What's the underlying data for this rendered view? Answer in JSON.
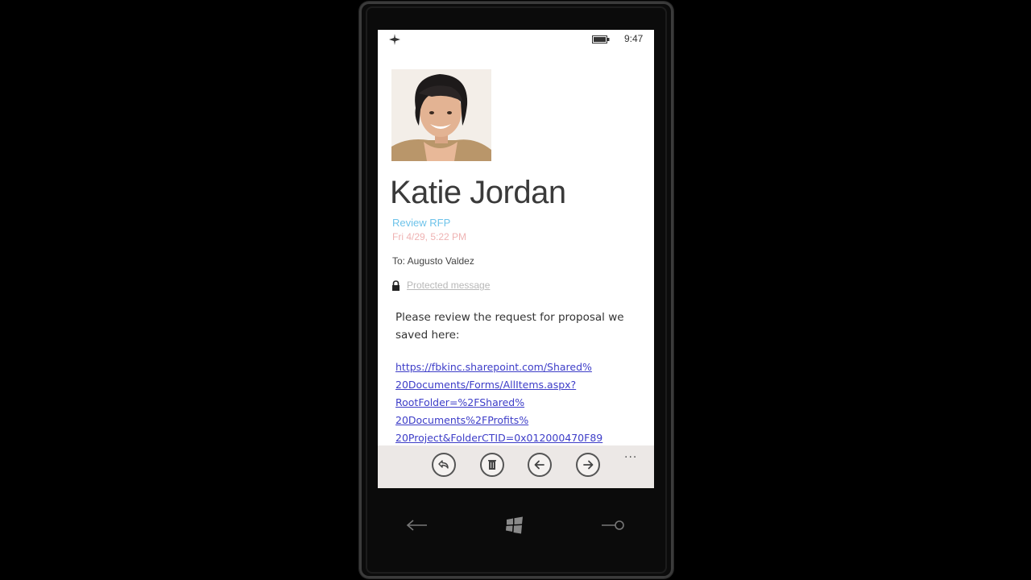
{
  "status_bar": {
    "time": "9:47",
    "airplane_icon": "airplane-icon",
    "battery_icon": "battery-icon"
  },
  "message": {
    "sender": "Katie Jordan",
    "subject": "Review RFP",
    "date": "Fri 4/29, 5:22 PM",
    "to": "To: Augusto Valdez",
    "protected_label": "Protected message",
    "body": "Please review the request for proposal we saved here:",
    "link_lines": [
      "https://fbkinc.sharepoint.com/Shared%",
      "20Documents/Forms/AllItems.aspx?",
      "RootFolder=%2FShared%",
      "20Documents%2FProfits%",
      "20Project&FolderCTID=0x012000470F89"
    ]
  },
  "app_bar": {
    "buttons": [
      "reply-icon",
      "delete-icon",
      "previous-icon",
      "next-icon"
    ],
    "more": "..."
  },
  "hardware_buttons": [
    "back-icon",
    "windows-start-icon",
    "search-icon"
  ],
  "colors": {
    "subject": "#6ec3ea",
    "date": "#efb3b3",
    "link": "#3d3dc8",
    "app_bar": "#ece8e6"
  }
}
